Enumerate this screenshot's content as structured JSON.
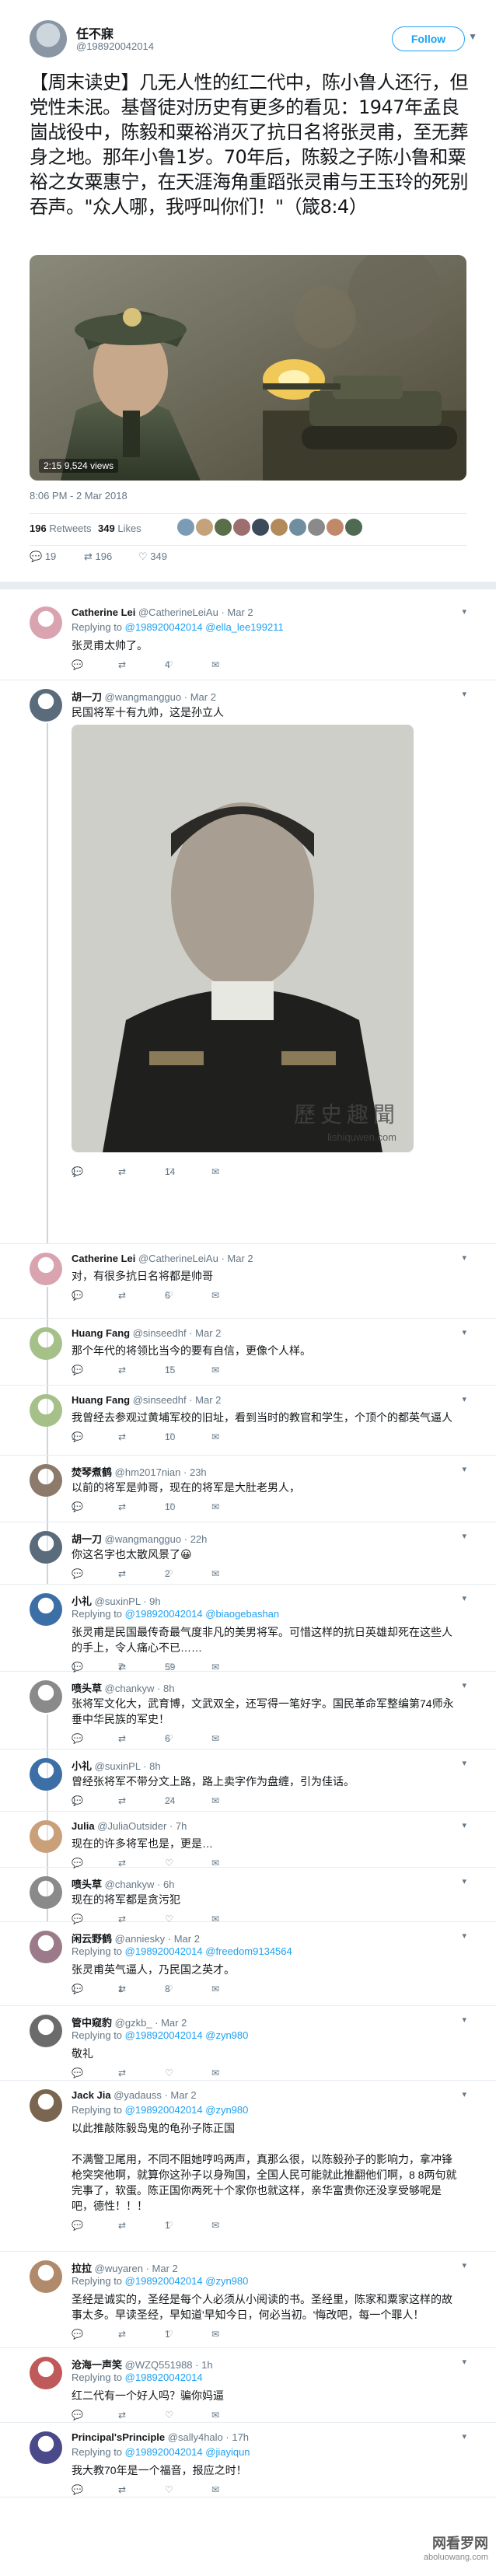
{
  "main": {
    "name": "任不寐",
    "handle": "@198920042014",
    "follow_label": "Follow",
    "text": "【周末读史】几无人性的红二代中，陈小鲁人还行，但党性未泯。基督徒对历史有更多的看见：1947年孟良崮战役中，陈毅和粟裕消灭了抗日名将张灵甫，至无葬身之地。那年小鲁1岁。70年后，陈毅之子陈小鲁和粟裕之女粟惠宁，在天涯海角重蹈张灵甫与王玉玲的死别吞声。\"众人哪，我呼叫你们！\"（箴8:4）",
    "video_time": "2:15",
    "video_views": "9,524 views",
    "time": "8:06 PM - 2 Mar 2018",
    "retweets_count": "196",
    "retweets_label": "Retweets",
    "likes_count": "349",
    "likes_label": "Likes",
    "actions": {
      "reply": "19",
      "retweet": "196",
      "like": "349"
    }
  },
  "replies": [
    {
      "name": "Catherine Lei",
      "handle": "@CatherineLeiAu",
      "date": "· Mar 2",
      "to": [
        "@198920042014",
        "@ella_lee199211"
      ],
      "text": [
        "张灵甫太帅了。"
      ],
      "reply": "",
      "retweet": "",
      "like": "4"
    },
    {
      "name": "胡一刀",
      "handle": "@wangmangguo",
      "date": "· Mar 2",
      "to": [],
      "text": [
        "民国将军十有九帅，这是孙立人"
      ],
      "photo_wm": "歷史趣聞",
      "photo_wm2": "lishiquwen.com",
      "reply": "1",
      "retweet": "",
      "like": "14"
    },
    {
      "name": "Catherine Lei",
      "handle": "@CatherineLeiAu",
      "date": "· Mar 2",
      "to": [],
      "text": [
        "对，有很多抗日名将都是帅哥"
      ],
      "reply": "1",
      "retweet": "",
      "like": "6"
    },
    {
      "name": "Huang Fang",
      "handle": "@sinseedhf",
      "date": "· Mar 2",
      "to": [],
      "text": [
        "那个年代的将领比当今的要有自信，更像个人样。"
      ],
      "reply": "1",
      "retweet": "",
      "like": "15"
    },
    {
      "name": "Huang Fang",
      "handle": "@sinseedhf",
      "date": "· Mar 2",
      "to": [],
      "text": [
        "我曾经去参观过黄埔军校的旧址，看到当时的教官和学生，个顶个的都英气逼人"
      ],
      "reply": "1",
      "retweet": "",
      "like": "10"
    },
    {
      "name": "焚琴煮鹤",
      "handle": "@hm2017nian",
      "date": "· 23h",
      "to": [],
      "text": [
        "以前的将军是帅哥，现在的将军是大肚老男人，"
      ],
      "reply": "1",
      "retweet": "",
      "like": "10"
    },
    {
      "name": "胡一刀",
      "handle": "@wangmangguo",
      "date": "· 22h",
      "to": [],
      "text": [
        "你这名字也太散风景了😀"
      ],
      "reply": "",
      "retweet": "",
      "like": "2"
    },
    {
      "name": "小礼",
      "handle": "@suxinPL",
      "date": "· 9h",
      "to": [
        "@198920042014",
        "@biaogebashan"
      ],
      "text": [
        "张灵甫是民国最传奇最气度非凡的美男将军。可惜这样的抗日英雄却死在这些人的手上，令人痛心不已……"
      ],
      "reply": "1",
      "retweet": "7",
      "like": "59"
    },
    {
      "name": "喷头草",
      "handle": "@chankyw",
      "date": "· 8h",
      "to": [],
      "text": [
        "张将军文化大，武育博，文武双全，还写得一笔好字。国民革命军整编第74师永垂中华民族的军史！"
      ],
      "reply": "",
      "retweet": "",
      "like": "6"
    },
    {
      "name": "小礼",
      "handle": "@suxinPL",
      "date": "· 8h",
      "to": [],
      "text": [
        "曾经张将军不带分文上路，路上卖字作为盘缠，引为佳话。"
      ],
      "reply": "1",
      "retweet": "",
      "like": "24"
    },
    {
      "name": "Julia",
      "handle": "@JuliaOutsider",
      "date": "· 7h",
      "to": [],
      "text": [
        "现在的许多将军也是，更是…"
      ],
      "reply": "",
      "retweet": "",
      "like": ""
    },
    {
      "name": "喷头草",
      "handle": "@chankyw",
      "date": "· 6h",
      "to": [],
      "text": [
        "现在的将军都是贪污犯"
      ],
      "reply": "",
      "retweet": "",
      "like": ""
    },
    {
      "name": "闲云野鹤",
      "handle": "@anniesky",
      "date": "· Mar 2",
      "to": [
        "@198920042014",
        "@freedom9134564"
      ],
      "text": [
        "张灵甫英气逼人，乃民国之英才。"
      ],
      "reply": "1",
      "retweet": "1",
      "like": "8"
    },
    {
      "name": "管中窥豹",
      "handle": "@gzkb_",
      "date": "· Mar 2",
      "to": [
        "@198920042014",
        "@zyn980"
      ],
      "text": [
        "敬礼"
      ],
      "reply": "",
      "retweet": "",
      "like": ""
    },
    {
      "name": "Jack Jia",
      "handle": "@yadauss",
      "date": "· Mar 2",
      "to": [
        "@198920042014",
        "@zyn980"
      ],
      "text": [
        "以此推敲陈毅岛鬼的龟孙子陈正国",
        "",
        "不满警卫尾用，不同不阻她哼呜两声，真那么很，以陈毅孙子的影响力，拿冲锋枪突突他啊，就算你这孙子以身殉国，全国人民可能就此推翻他们啊，8 8两句就完事了，软蛋。陈正国你两死十个家你也就这样，亲华富贵你还没享受够呢是吧，德性！！！"
      ],
      "reply": "",
      "retweet": "",
      "like": "1"
    },
    {
      "name": "拉拉",
      "handle": "@wuyaren",
      "date": "· Mar 2",
      "to": [
        "@198920042014",
        "@zyn980"
      ],
      "text": [
        "圣经是诚实的，圣经是每个人必须从小阅读的书。圣经里，陈家和粟家这样的故事太多。早读圣经，早知道'早知今日，何必当初。'悔改吧，每一个罪人！"
      ],
      "reply": "",
      "retweet": "",
      "like": "1"
    },
    {
      "name": "沧海一声笑",
      "handle": "@WZQ551988",
      "date": "· 1h",
      "to": [
        "@198920042014"
      ],
      "text": [
        "红二代有一个好人吗？骗你妈逼"
      ],
      "reply": "",
      "retweet": "",
      "like": ""
    },
    {
      "name": "Principal'sPrinciple",
      "handle": "@sally4halo",
      "date": "· 17h",
      "to": [
        "@198920042014",
        "@jiayiqun"
      ],
      "text": [
        "我大教70年是一个福音，报应之时！"
      ],
      "reply": "",
      "retweet": "",
      "like": ""
    }
  ],
  "corner_watermark": {
    "line1": "网看罗网",
    "line2": "aboluowang.com"
  }
}
